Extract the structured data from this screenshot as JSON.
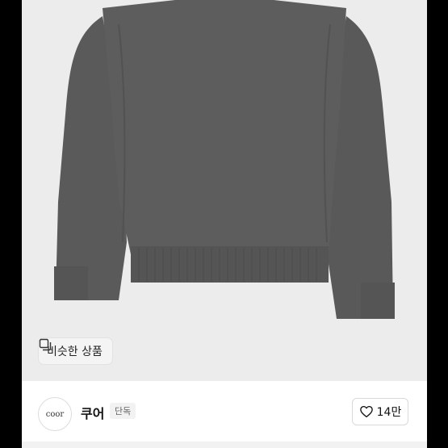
{
  "product_image": {
    "alt": ""
  },
  "similar_products": {
    "label": "비슷한 상품",
    "icon": "similar-items-icon"
  },
  "brand": {
    "logo_text": "coor",
    "name": "쿠어",
    "badge": "단독"
  },
  "likes": {
    "count": "14만",
    "icon": "heart-outline-icon"
  },
  "colors": {
    "photo_bg": "#ececec",
    "sweater": "#5b5b5b"
  }
}
